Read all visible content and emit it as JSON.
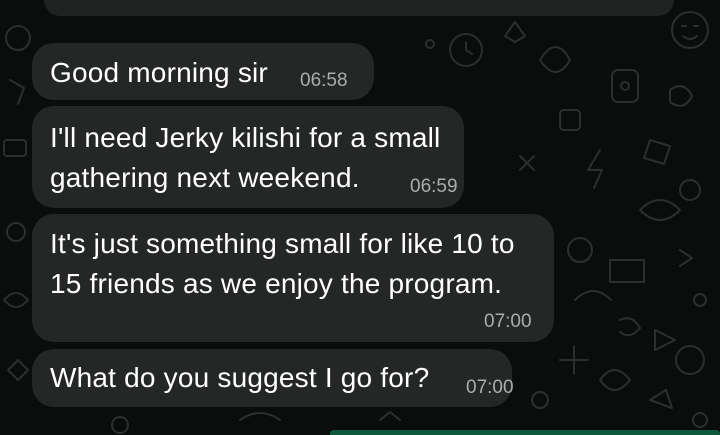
{
  "chat": {
    "messages": [
      {
        "lines": [
          "Good morning sir"
        ],
        "time": "06:58"
      },
      {
        "lines": [
          "I'll need Jerky kilishi for a small",
          "gathering next weekend."
        ],
        "time": "06:59"
      },
      {
        "lines": [
          "It's just something small for like 10 to",
          "15 friends as we enjoy the program."
        ],
        "time": "07:00"
      },
      {
        "lines": [
          "What do you suggest I go for?"
        ],
        "time": "07:00"
      }
    ]
  },
  "theme": {
    "background": "#0b0d0c",
    "bubble": "#242726",
    "timestamp": "#a9adab",
    "accent": "#0f5a3c"
  }
}
